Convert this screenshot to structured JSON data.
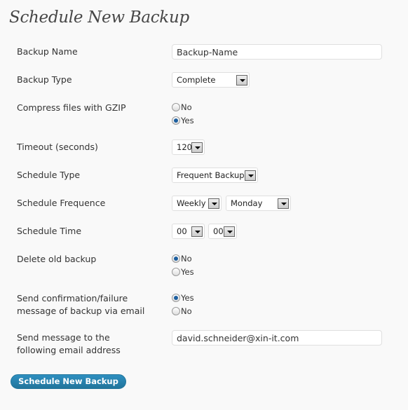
{
  "title": "Schedule New Backup",
  "fields": {
    "backup_name": {
      "label": "Backup Name",
      "value": "Backup-Name"
    },
    "backup_type": {
      "label": "Backup Type",
      "value": "Complete"
    },
    "gzip": {
      "label": "Compress files with GZIP",
      "options": [
        "No",
        "Yes"
      ],
      "selected": "Yes"
    },
    "timeout": {
      "label": "Timeout (seconds)",
      "value": "120"
    },
    "schedule_type": {
      "label": "Schedule Type",
      "value": "Frequent Backup"
    },
    "frequence": {
      "label": "Schedule Frequence",
      "value": "Weekly",
      "day": "Monday"
    },
    "time": {
      "label": "Schedule Time",
      "hour": "00",
      "minute": "00",
      "separator": ":"
    },
    "delete_old": {
      "label": "Delete old backup",
      "options": [
        "No",
        "Yes"
      ],
      "selected": "No"
    },
    "send_confirm": {
      "label_line1": "Send confirmation/failure",
      "label_line2": "message of backup via email",
      "options": [
        "Yes",
        "No"
      ],
      "selected": "Yes"
    },
    "email": {
      "label_line1": "Send message to the",
      "label_line2": "following email address",
      "value": "david.schneider@xin-it.com"
    }
  },
  "submit_label": "Schedule New Backup"
}
